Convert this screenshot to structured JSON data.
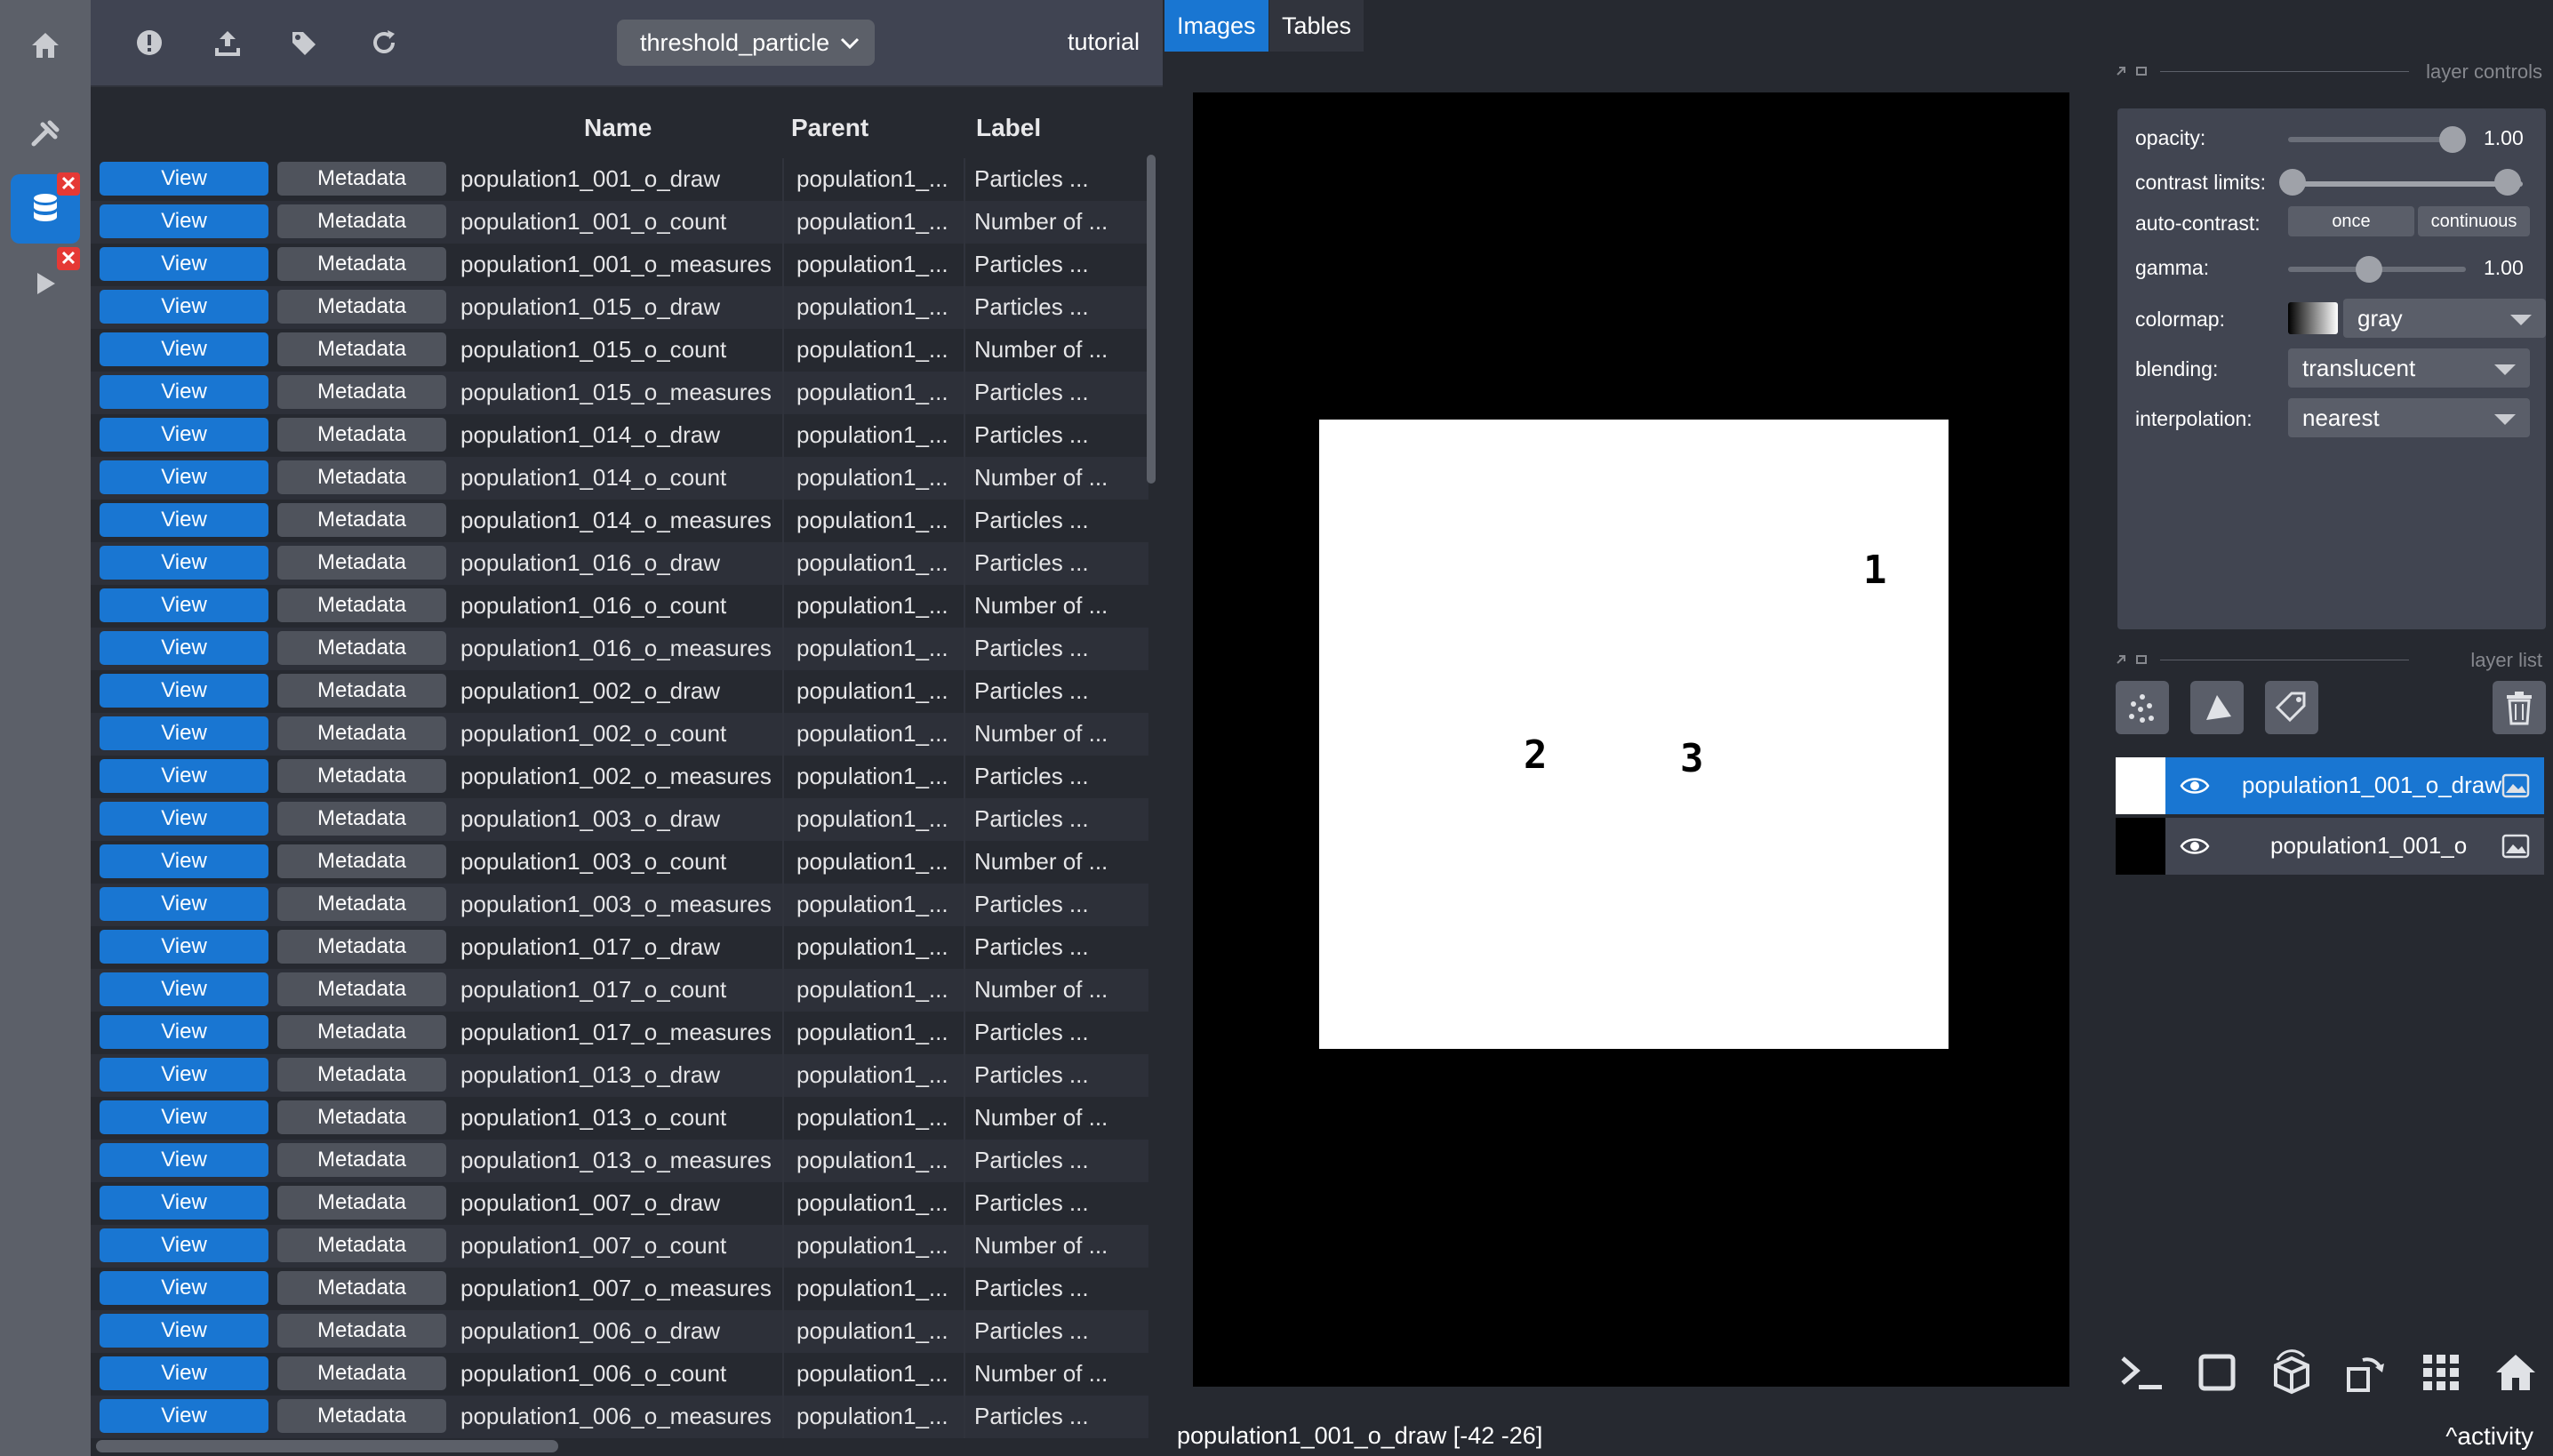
{
  "rail": {
    "badge_close": "✕"
  },
  "toolbar": {
    "dataset_select": "threshold_particle",
    "project": "tutorial"
  },
  "table": {
    "headers": {
      "name": "Name",
      "parent": "Parent",
      "label": "Label"
    },
    "view_label": "View",
    "metadata_label": "Metadata",
    "rows": [
      {
        "name": "population1_001_o_draw",
        "parent": "population1_...",
        "label": "Particles ..."
      },
      {
        "name": "population1_001_o_count",
        "parent": "population1_...",
        "label": "Number of ..."
      },
      {
        "name": "population1_001_o_measures",
        "parent": "population1_...",
        "label": "Particles ..."
      },
      {
        "name": "population1_015_o_draw",
        "parent": "population1_...",
        "label": "Particles ..."
      },
      {
        "name": "population1_015_o_count",
        "parent": "population1_...",
        "label": "Number of ..."
      },
      {
        "name": "population1_015_o_measures",
        "parent": "population1_...",
        "label": "Particles ..."
      },
      {
        "name": "population1_014_o_draw",
        "parent": "population1_...",
        "label": "Particles ..."
      },
      {
        "name": "population1_014_o_count",
        "parent": "population1_...",
        "label": "Number of ..."
      },
      {
        "name": "population1_014_o_measures",
        "parent": "population1_...",
        "label": "Particles ..."
      },
      {
        "name": "population1_016_o_draw",
        "parent": "population1_...",
        "label": "Particles ..."
      },
      {
        "name": "population1_016_o_count",
        "parent": "population1_...",
        "label": "Number of ..."
      },
      {
        "name": "population1_016_o_measures",
        "parent": "population1_...",
        "label": "Particles ..."
      },
      {
        "name": "population1_002_o_draw",
        "parent": "population1_...",
        "label": "Particles ..."
      },
      {
        "name": "population1_002_o_count",
        "parent": "population1_...",
        "label": "Number of ..."
      },
      {
        "name": "population1_002_o_measures",
        "parent": "population1_...",
        "label": "Particles ..."
      },
      {
        "name": "population1_003_o_draw",
        "parent": "population1_...",
        "label": "Particles ..."
      },
      {
        "name": "population1_003_o_count",
        "parent": "population1_...",
        "label": "Number of ..."
      },
      {
        "name": "population1_003_o_measures",
        "parent": "population1_...",
        "label": "Particles ..."
      },
      {
        "name": "population1_017_o_draw",
        "parent": "population1_...",
        "label": "Particles ..."
      },
      {
        "name": "population1_017_o_count",
        "parent": "population1_...",
        "label": "Number of ..."
      },
      {
        "name": "population1_017_o_measures",
        "parent": "population1_...",
        "label": "Particles ..."
      },
      {
        "name": "population1_013_o_draw",
        "parent": "population1_...",
        "label": "Particles ..."
      },
      {
        "name": "population1_013_o_count",
        "parent": "population1_...",
        "label": "Number of ..."
      },
      {
        "name": "population1_013_o_measures",
        "parent": "population1_...",
        "label": "Particles ..."
      },
      {
        "name": "population1_007_o_draw",
        "parent": "population1_...",
        "label": "Particles ..."
      },
      {
        "name": "population1_007_o_count",
        "parent": "population1_...",
        "label": "Number of ..."
      },
      {
        "name": "population1_007_o_measures",
        "parent": "population1_...",
        "label": "Particles ..."
      },
      {
        "name": "population1_006_o_draw",
        "parent": "population1_...",
        "label": "Particles ..."
      },
      {
        "name": "population1_006_o_count",
        "parent": "population1_...",
        "label": "Number of ..."
      },
      {
        "name": "population1_006_o_measures",
        "parent": "population1_...",
        "label": "Particles ..."
      }
    ]
  },
  "viewer": {
    "tabs": [
      {
        "label": "Images",
        "active": true
      },
      {
        "label": "Tables",
        "active": false
      }
    ],
    "particles": [
      "1",
      "2",
      "3"
    ],
    "status": "population1_001_o_draw [-42 -26]",
    "activity": "activity"
  },
  "layer_controls": {
    "title": "layer controls",
    "opacity_label": "opacity:",
    "opacity_value": "1.00",
    "contrast_label": "contrast limits:",
    "autocontrast_label": "auto-contrast:",
    "once": "once",
    "continuous": "continuous",
    "gamma_label": "gamma:",
    "gamma_value": "1.00",
    "colormap_label": "colormap:",
    "colormap": "gray",
    "blending_label": "blending:",
    "blending": "translucent",
    "interpolation_label": "interpolation:",
    "interpolation": "nearest"
  },
  "layer_list": {
    "title": "layer list",
    "layers": [
      {
        "name": "population1_001_o_draw",
        "selected": true
      },
      {
        "name": "population1_001_o",
        "selected": false
      }
    ]
  },
  "colors": {
    "accent": "#1976d2",
    "background": "#262930",
    "panel": "#414551",
    "close_badge": "#e53935"
  }
}
